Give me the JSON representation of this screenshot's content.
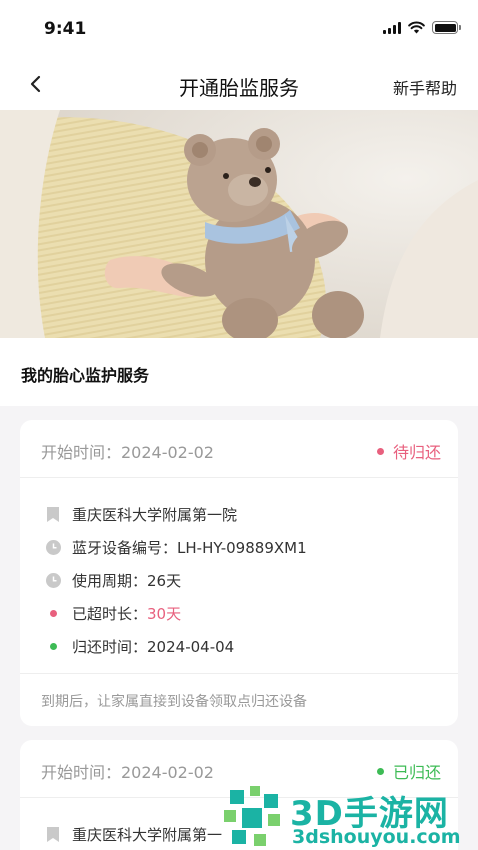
{
  "status_bar": {
    "time": "9:41"
  },
  "nav": {
    "title": "开通胎监服务",
    "help": "新手帮助"
  },
  "section": {
    "title": "我的胎心监护服务"
  },
  "cards": [
    {
      "start": "开始时间：2024-02-02",
      "status": "待归还",
      "status_color": "#e8607e",
      "hospital": "重庆医科大学附属第一院",
      "device_label": "蓝牙设备编号：",
      "device": "LH-HY-09889XM1",
      "period_label": "使用周期：",
      "period": "26天",
      "overtime_label": "已超时长：",
      "overtime": "30天",
      "return_label": "归还时间：",
      "return_time": "2024-04-04",
      "note": "到期后，让家属直接到设备领取点归还设备"
    },
    {
      "start": "开始时间：2024-02-02",
      "status": "已归还",
      "status_color": "#3dbb55",
      "hospital": "重庆医科大学附属第一"
    }
  ],
  "colors": {
    "overtime_pink": "#e8607e",
    "returned_green": "#3dbb55",
    "icon_gray": "#c9c9c9"
  },
  "watermark": {
    "brand": "3D手游网",
    "domain": "3dshouyou.com"
  }
}
